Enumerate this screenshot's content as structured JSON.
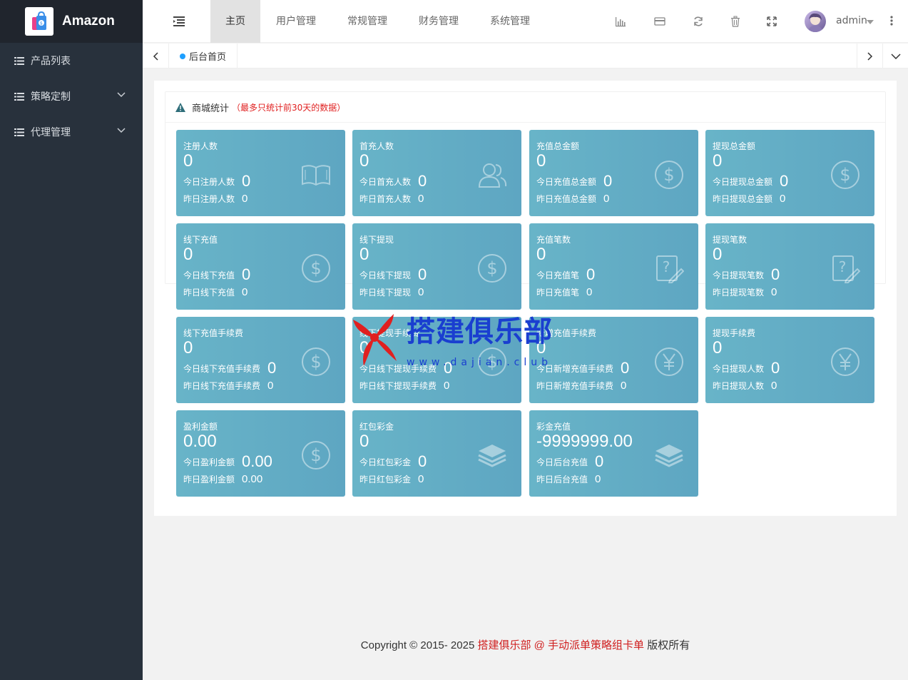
{
  "app": {
    "brand": "Amazon"
  },
  "sidebar": {
    "items": [
      {
        "label": "产品列表",
        "has_children": false
      },
      {
        "label": "策略定制",
        "has_children": true
      },
      {
        "label": "代理管理",
        "has_children": true
      }
    ]
  },
  "header": {
    "tabs": [
      {
        "label": "主页",
        "active": true
      },
      {
        "label": "用户管理",
        "active": false
      },
      {
        "label": "常规管理",
        "active": false
      },
      {
        "label": "财务管理",
        "active": false
      },
      {
        "label": "系统管理",
        "active": false
      }
    ],
    "icons": [
      "chart-icon",
      "card-icon",
      "refresh-icon",
      "trash-icon",
      "fullscreen-icon"
    ],
    "user": {
      "name": "admin"
    }
  },
  "tabbar": {
    "current_tab": "后台首页"
  },
  "stats_card": {
    "title": "商城统计",
    "note": "（最多只统计前30天的数据）",
    "tiles": [
      {
        "title": "注册人数",
        "value": "0",
        "today_label": "今日注册人数",
        "today_value": "0",
        "yesterday_label": "昨日注册人数",
        "yesterday_value": "0",
        "icon": "book-icon"
      },
      {
        "title": "首充人数",
        "value": "0",
        "today_label": "今日首充人数",
        "today_value": "0",
        "yesterday_label": "昨日首充人数",
        "yesterday_value": "0",
        "icon": "users-icon"
      },
      {
        "title": "充值总金额",
        "value": "0",
        "today_label": "今日充值总金额",
        "today_value": "0",
        "yesterday_label": "昨日充值总金额",
        "yesterday_value": "0",
        "icon": "dollar-icon"
      },
      {
        "title": "提现总金额",
        "value": "0",
        "today_label": "今日提现总金额",
        "today_value": "0",
        "yesterday_label": "昨日提现总金额",
        "yesterday_value": "0",
        "icon": "dollar-icon"
      },
      {
        "title": "线下充值",
        "value": "0",
        "today_label": "今日线下充值",
        "today_value": "0",
        "yesterday_label": "昨日线下充值",
        "yesterday_value": "0",
        "icon": "dollar-icon"
      },
      {
        "title": "线下提现",
        "value": "0",
        "today_label": "今日线下提现",
        "today_value": "0",
        "yesterday_label": "昨日线下提现",
        "yesterday_value": "0",
        "icon": "dollar-icon"
      },
      {
        "title": "充值笔数",
        "value": "0",
        "today_label": "今日充值笔",
        "today_value": "0",
        "yesterday_label": "昨日充值笔",
        "yesterday_value": "0",
        "icon": "question-edit-icon"
      },
      {
        "title": "提现笔数",
        "value": "0",
        "today_label": "今日提现笔数",
        "today_value": "0",
        "yesterday_label": "昨日提现笔数",
        "yesterday_value": "0",
        "icon": "question-edit-icon"
      },
      {
        "title": "线下充值手续费",
        "value": "0",
        "today_label": "今日线下充值手续费",
        "today_value": "0",
        "yesterday_label": "昨日线下充值手续费",
        "yesterday_value": "0",
        "icon": "dollar-icon"
      },
      {
        "title": "线下提现手续费",
        "value": "0",
        "today_label": "今日线下提现手续费",
        "today_value": "0",
        "yesterday_label": "昨日线下提现手续费",
        "yesterday_value": "0",
        "icon": "dollar-icon"
      },
      {
        "title": "新增充值手续费",
        "value": "0",
        "today_label": "今日新增充值手续费",
        "today_value": "0",
        "yesterday_label": "昨日新增充值手续费",
        "yesterday_value": "0",
        "icon": "yen-icon"
      },
      {
        "title": "提现手续费",
        "value": "0",
        "today_label": "今日提现人数",
        "today_value": "0",
        "yesterday_label": "昨日提现人数",
        "yesterday_value": "0",
        "icon": "yen-icon"
      },
      {
        "title": "盈利金额",
        "value": "0.00",
        "today_label": "今日盈利金额",
        "today_value": "0.00",
        "yesterday_label": "昨日盈利金额",
        "yesterday_value": "0.00",
        "icon": "dollar-icon"
      },
      {
        "title": "红包彩金",
        "value": "0",
        "today_label": "今日红包彩金",
        "today_value": "0",
        "yesterday_label": "昨日红包彩金",
        "yesterday_value": "0",
        "icon": "layers-icon"
      },
      {
        "title": "彩金充值",
        "value": "-9999999.00",
        "today_label": "今日后台充值",
        "today_value": "0",
        "yesterday_label": "昨日后台充值",
        "yesterday_value": "0",
        "icon": "layers-icon"
      }
    ]
  },
  "watermark": {
    "text": "搭建俱乐部",
    "sub": "www.dajian.club"
  },
  "footer": {
    "prefix": "Copyright © 2015- 2025 ",
    "link": "搭建俱乐部 @ 手动派单策略组卡单",
    "suffix": " 版权所有"
  }
}
